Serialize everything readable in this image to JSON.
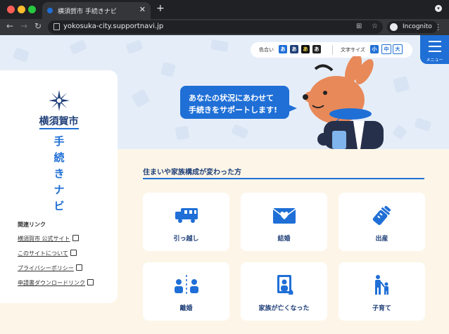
{
  "browser": {
    "tab_title": "横須賀市 手続きナビ",
    "url": "yokosuka-city.supportnavi.jp",
    "profile_label": "Incognito"
  },
  "site": {
    "city_name": "横須賀市",
    "title_vertical": [
      "手",
      "続",
      "き",
      "ナ",
      "ビ"
    ]
  },
  "settings": {
    "color_label": "色合い",
    "color_options": [
      "あ",
      "あ",
      "あ",
      "あ"
    ],
    "size_label": "文字サイズ",
    "size_options": [
      "小",
      "中",
      "大"
    ]
  },
  "menu": {
    "label": "メニュー"
  },
  "hero": {
    "bubble_line1": "あなたの状況にあわせて",
    "bubble_line2": "手続きをサポートします!"
  },
  "related_links": {
    "heading": "関連リンク",
    "items": [
      "横須賀市 公式サイト",
      "このサイトについて",
      "プライバシーポリシー",
      "申請書ダウンロードリンク"
    ]
  },
  "section": {
    "title": "住まいや家族構成が変わった方",
    "cards": [
      {
        "label": "引っ越し",
        "icon": "moving-truck-icon"
      },
      {
        "label": "結婚",
        "icon": "heart-envelope-icon"
      },
      {
        "label": "出産",
        "icon": "baby-bottle-icon"
      },
      {
        "label": "離婚",
        "icon": "separated-couple-icon"
      },
      {
        "label": "家族が亡くなった",
        "icon": "memorial-portrait-icon"
      },
      {
        "label": "子育て",
        "icon": "parent-child-icon"
      }
    ]
  },
  "colors": {
    "accent": "#1f6fd6",
    "navy": "#1f3f78",
    "cream": "#fdf6e8",
    "hero_bg": "#e5eef8"
  }
}
